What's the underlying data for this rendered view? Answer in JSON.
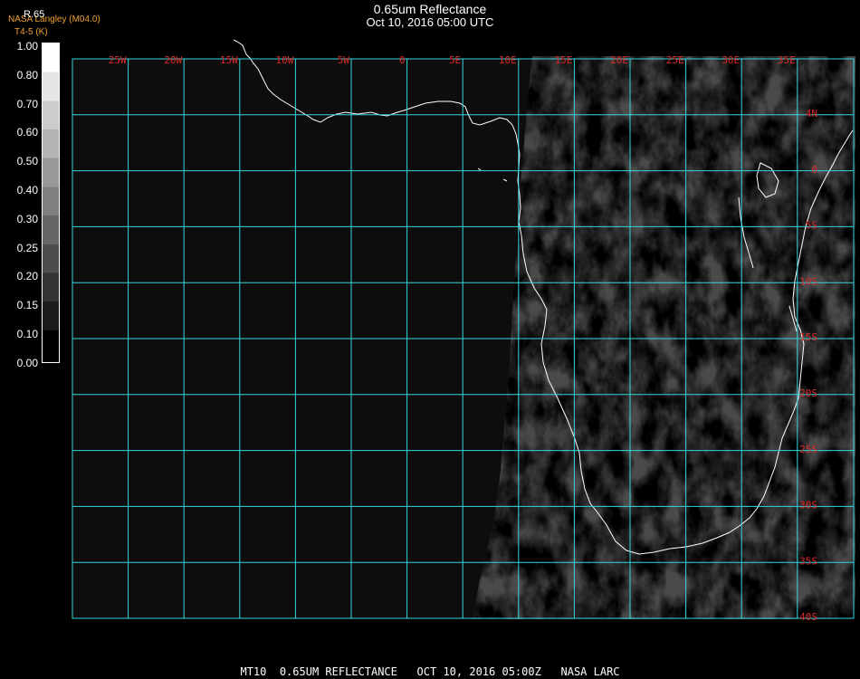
{
  "title": "0.65um Reflectance",
  "subtitle": "Oct 10, 2016 05:00 UTC",
  "credit_line1": "NASA Langley (M04.0)",
  "credit_line2": "T4-5 (K)",
  "colorbar": {
    "label": "R.65",
    "ticks": [
      "1.00",
      "0.80",
      "0.70",
      "0.60",
      "0.50",
      "0.40",
      "0.30",
      "0.25",
      "0.20",
      "0.15",
      "0.10",
      "0.00"
    ]
  },
  "grid": {
    "lon_labels": [
      "25W",
      "20W",
      "15W",
      "10W",
      "5W",
      "0",
      "5E",
      "10E",
      "15E",
      "20E",
      "25E",
      "30E",
      "35E"
    ],
    "lat_labels": [
      "4N",
      "0",
      "5S",
      "10S",
      "15S",
      "20S",
      "25S",
      "30S",
      "35S",
      "40S"
    ],
    "line_color": "#35d6e0",
    "label_color": "#dd2a2a"
  },
  "footer": "MT10  0.65UM REFLECTANCE   OCT 10, 2016 05:00Z   NASA LARC"
}
